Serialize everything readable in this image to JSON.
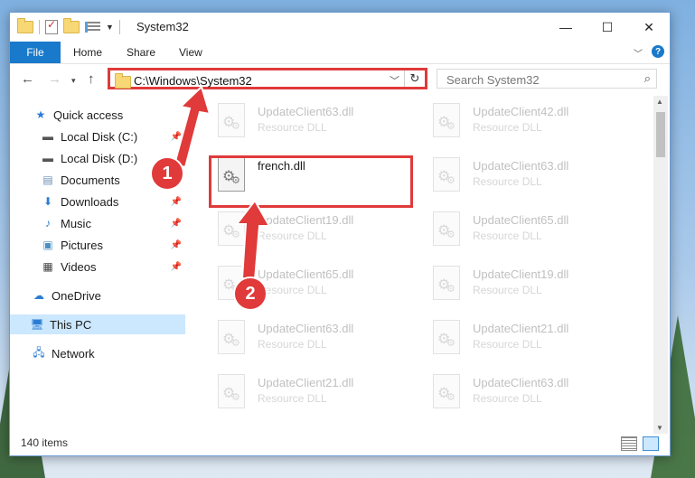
{
  "window": {
    "title": "System32"
  },
  "ribbon": {
    "tabs": [
      "File",
      "Home",
      "Share",
      "View"
    ],
    "help": "?"
  },
  "nav": {
    "address": "C:\\Windows\\System32",
    "search_placeholder": "Search System32"
  },
  "sidebar": {
    "items": [
      {
        "label": "Quick access",
        "icon": "star-icon",
        "pinned": false
      },
      {
        "label": "Local Disk (C:)",
        "icon": "drive-icon",
        "pinned": true
      },
      {
        "label": "Local Disk (D:)",
        "icon": "drive-icon",
        "pinned": false
      },
      {
        "label": "Documents",
        "icon": "documents-icon",
        "pinned": true
      },
      {
        "label": "Downloads",
        "icon": "download-icon",
        "pinned": true
      },
      {
        "label": "Music",
        "icon": "music-icon",
        "pinned": true
      },
      {
        "label": "Pictures",
        "icon": "pictures-icon",
        "pinned": true
      },
      {
        "label": "Videos",
        "icon": "videos-icon",
        "pinned": true
      },
      {
        "label": "OneDrive",
        "icon": "cloud-icon",
        "pinned": false
      },
      {
        "label": "This PC",
        "icon": "computer-icon",
        "pinned": false,
        "selected": true
      },
      {
        "label": "Network",
        "icon": "network-icon",
        "pinned": false
      }
    ]
  },
  "files": {
    "left_column": [
      {
        "name": "UpdateClient63.dll",
        "type": "Resource DLL"
      },
      {
        "name": "french.dll",
        "type": ""
      },
      {
        "name": "UpdateClient19.dll",
        "type": "Resource DLL"
      },
      {
        "name": "UpdateClient65.dll",
        "type": "Resource DLL"
      },
      {
        "name": "UpdateClient63.dll",
        "type": "Resource DLL"
      },
      {
        "name": "UpdateClient21.dll",
        "type": "Resource DLL"
      }
    ],
    "right_column": [
      {
        "name": "UpdateClient42.dll",
        "type": "Resource DLL"
      },
      {
        "name": "UpdateClient63.dll",
        "type": "Resource DLL"
      },
      {
        "name": "UpdateClient65.dll",
        "type": "Resource DLL"
      },
      {
        "name": "UpdateClient19.dll",
        "type": "Resource DLL"
      },
      {
        "name": "UpdateClient21.dll",
        "type": "Resource DLL"
      },
      {
        "name": "UpdateClient63.dll",
        "type": "Resource DLL"
      }
    ]
  },
  "status": {
    "item_count": "140 items"
  },
  "callouts": {
    "one": "1",
    "two": "2"
  },
  "colors": {
    "accent": "#1979ca",
    "highlight": "#e03a3a",
    "selected_bg": "#cce8ff"
  }
}
